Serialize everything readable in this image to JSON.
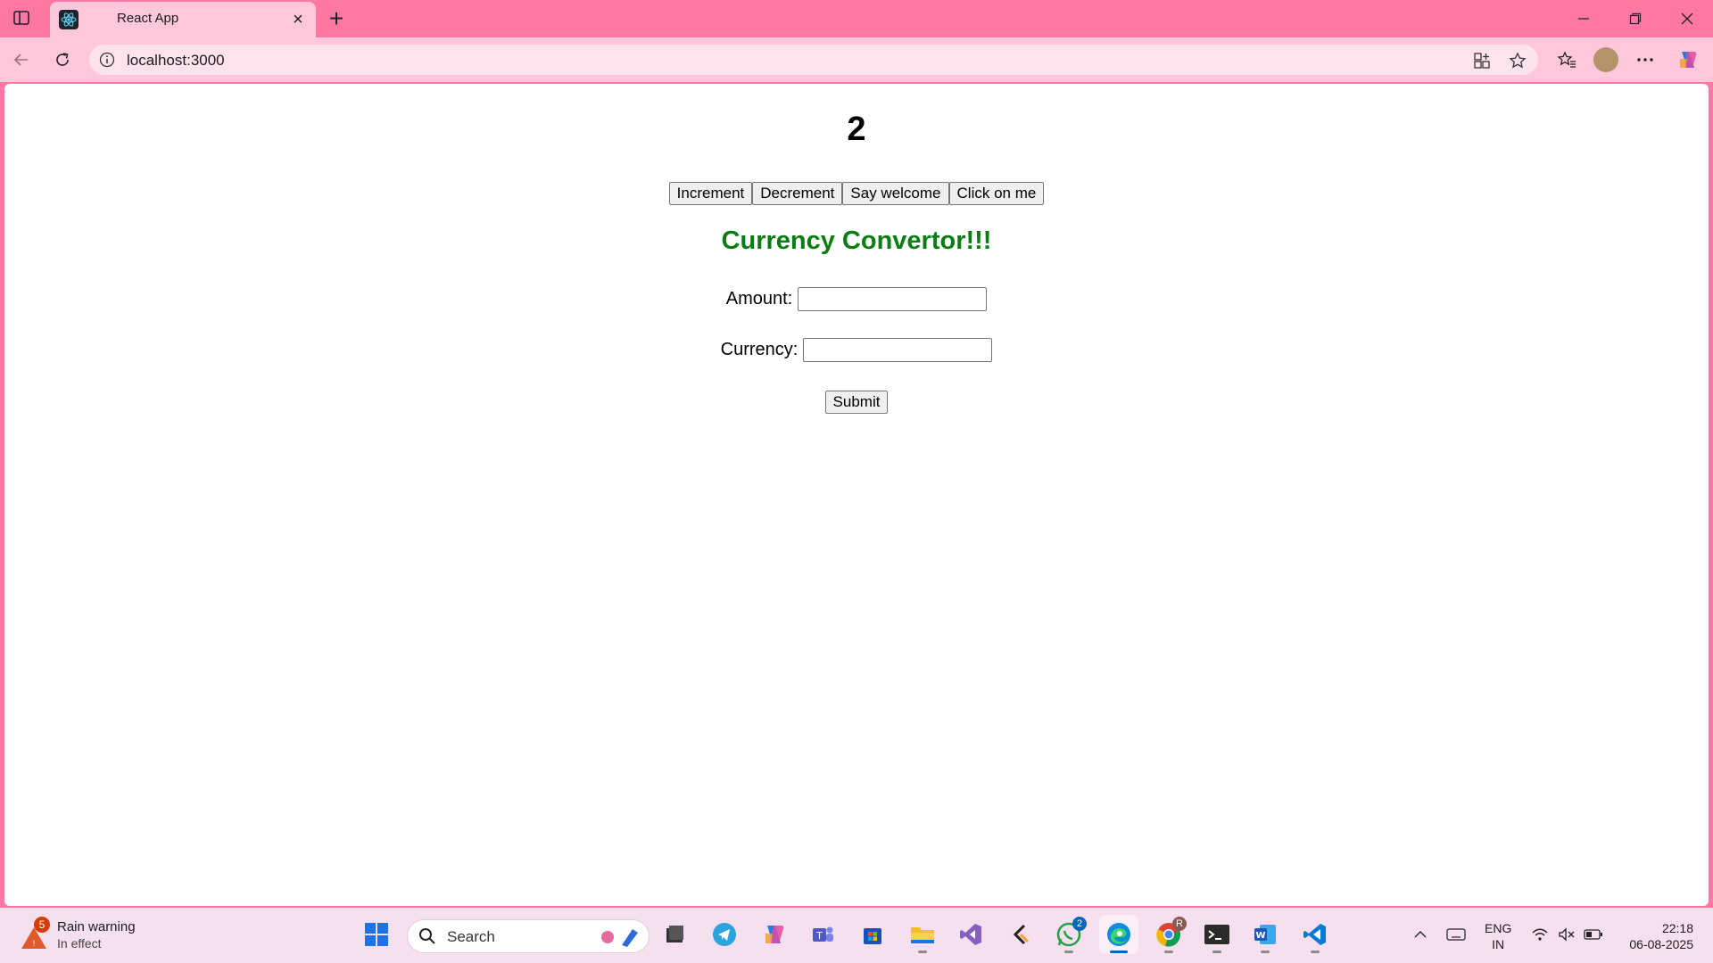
{
  "browser": {
    "tab_title": "React App",
    "url": "localhost:3000"
  },
  "page": {
    "count": "2",
    "buttons": [
      "Increment",
      "Decrement",
      "Say welcome",
      "Click on me"
    ],
    "heading": "Currency Convertor!!!",
    "amount_label": "Amount:",
    "amount_value": "",
    "currency_label": "Currency:",
    "currency_value": "",
    "submit_label": "Submit",
    "heading_color": "#0a7d12"
  },
  "taskbar": {
    "weather_badge": "5",
    "weather_title": "Rain warning",
    "weather_subtitle": "In effect",
    "search_placeholder": "Search",
    "whatsapp_badge": "2",
    "chrome_badge": "R",
    "language_line1": "ENG",
    "language_line2": "IN",
    "time": "22:18",
    "date": "06-08-2025",
    "apps": [
      "start-icon",
      "copilot-icon",
      "file-manager-icon",
      "telegram-icon",
      "copilot-app-icon",
      "teams-icon",
      "store-icon",
      "file-explorer-icon",
      "visual-studio-icon",
      "claude-icon",
      "whatsapp-icon",
      "edge-icon",
      "chrome-icon",
      "terminal-icon",
      "word-icon",
      "vscode-icon"
    ]
  },
  "colors": {
    "titlebar": "#ff77a3",
    "toolbar": "#ffc8da",
    "taskbar": "#f6dfee"
  }
}
